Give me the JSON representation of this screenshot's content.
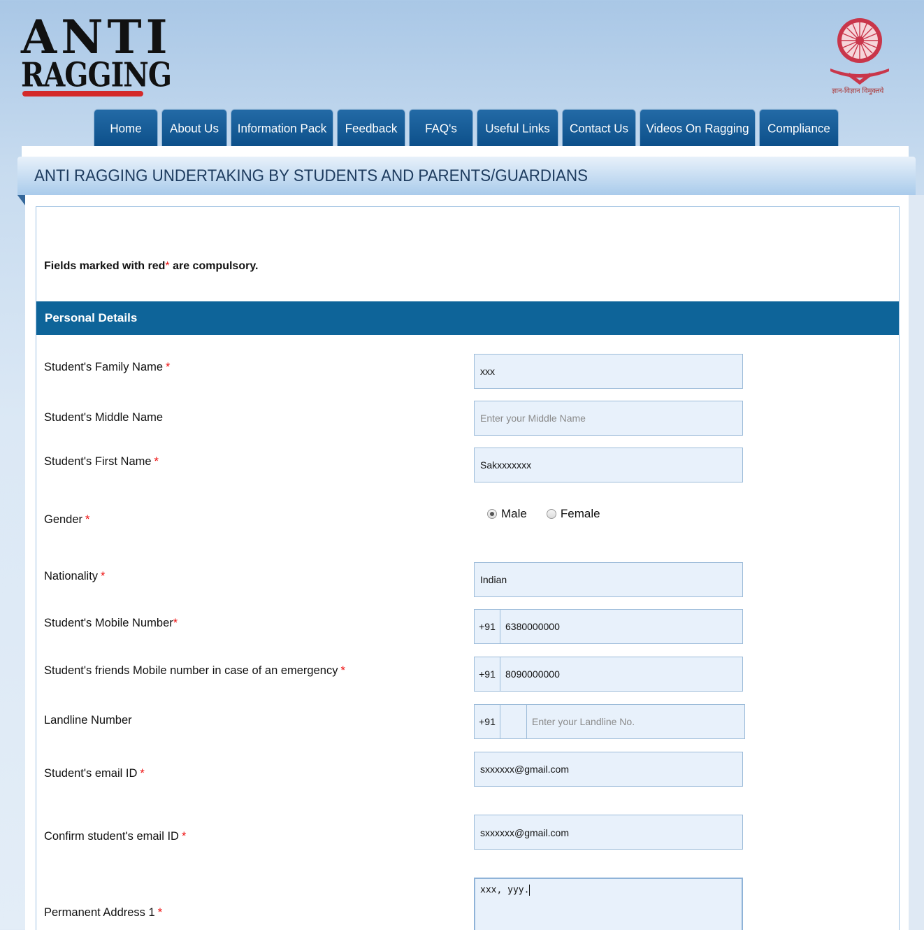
{
  "logo": {
    "line1": "ANTI",
    "line2": "RAGGING"
  },
  "emblem": {
    "name": "ugc-emblem-icon",
    "caption": "ज्ञान-विज्ञान विमुक्तये"
  },
  "nav": [
    {
      "label": "Home"
    },
    {
      "label": "About Us"
    },
    {
      "label": "Information Pack"
    },
    {
      "label": "Feedback"
    },
    {
      "label": "FAQ's"
    },
    {
      "label": "Useful Links"
    },
    {
      "label": "Contact Us"
    },
    {
      "label": "Videos On Ragging"
    },
    {
      "label": "Compliance"
    }
  ],
  "page_title": "ANTI RAGGING UNDERTAKING BY STUDENTS AND PARENTS/GUARDIANS",
  "note": {
    "prefix": "Fields marked with red",
    "star": "*",
    "suffix": " are compulsory."
  },
  "section": {
    "title": "Personal Details"
  },
  "form": {
    "family_name": {
      "label": "Student's Family Name",
      "star": "*",
      "value": "xxx"
    },
    "middle_name": {
      "label": "Student's Middle Name",
      "placeholder": "Enter your Middle Name"
    },
    "first_name": {
      "label": "Student's First Name",
      "star": "*",
      "value": "Sakxxxxxxx"
    },
    "gender": {
      "label": "Gender",
      "star": "*",
      "options": [
        "Male",
        "Female"
      ],
      "selected": "Male"
    },
    "nationality": {
      "label": "Nationality",
      "star": "*",
      "value": "Indian"
    },
    "mobile": {
      "label": "Student's Mobile Number",
      "star": "*",
      "code": "+91",
      "value": "6380000000"
    },
    "friend_mobile": {
      "label": "Student's friends Mobile number in case of an emergency",
      "star": "*",
      "code": "+91",
      "value": "8090000000"
    },
    "landline": {
      "label": "Landline Number",
      "code": "+91",
      "placeholder": "Enter your Landline No."
    },
    "email": {
      "label": "Student's email ID",
      "star": "*",
      "value": "sxxxxxx@gmail.com"
    },
    "confirm_email": {
      "label": "Confirm student's email ID",
      "star": "*",
      "value": "sxxxxxx@gmail.com"
    },
    "address1": {
      "label": "Permanent Address 1",
      "star": "*",
      "value": "xxx, yyy."
    }
  },
  "colors": {
    "nav_tab": "#0c4f89",
    "section_bar": "#0e6499",
    "required": "#e11111",
    "input_bg": "#e8f1fb"
  }
}
